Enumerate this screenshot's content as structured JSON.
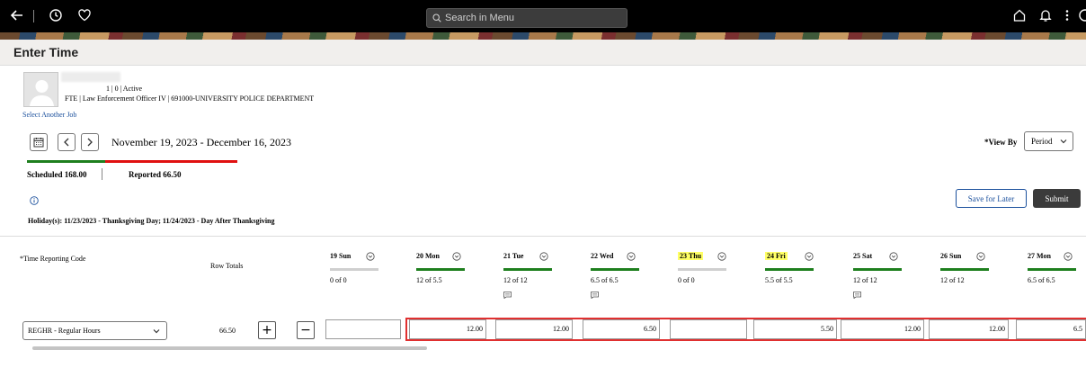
{
  "topbar": {
    "search_placeholder": "Search in Menu"
  },
  "page": {
    "title": "Enter Time"
  },
  "employee": {
    "status_line": "1 | 0 | Active",
    "job_line": "FTE | Law Enforcement Officer IV | 691000-UNIVERSITY POLICE DEPARTMENT",
    "select_job_link": "Select Another Job"
  },
  "period": {
    "range": "November 19, 2023 - December 16, 2023"
  },
  "view_by": {
    "label": "*View By",
    "value": "Period"
  },
  "summary": {
    "scheduled": "Scheduled  168.00",
    "reported": "Reported  66.50",
    "scheduled_hours": 168.0,
    "reported_hours": 66.5
  },
  "holiday_text": "Holiday(s): 11/23/2023 - Thanksgiving Day; 11/24/2023 - Day After Thanksgiving",
  "actions": {
    "save_for_later": "Save for Later",
    "submit": "Submit"
  },
  "grid": {
    "trc_header": "*Time Reporting Code",
    "row_totals_header": "Row Totals",
    "days": [
      {
        "label": "19 Sun",
        "hours": "0 of 0",
        "holiday": false,
        "bar": "grey",
        "comment": false
      },
      {
        "label": "20 Mon",
        "hours": "12 of 5.5",
        "holiday": false,
        "bar": "green",
        "comment": false
      },
      {
        "label": "21 Tue",
        "hours": "12 of 12",
        "holiday": false,
        "bar": "green",
        "comment": true
      },
      {
        "label": "22 Wed",
        "hours": "6.5 of 6.5",
        "holiday": false,
        "bar": "green",
        "comment": true
      },
      {
        "label": "23 Thu",
        "hours": "0 of 0",
        "holiday": true,
        "bar": "grey",
        "comment": false
      },
      {
        "label": "24 Fri",
        "hours": "5.5 of 5.5",
        "holiday": true,
        "bar": "green",
        "comment": false
      },
      {
        "label": "25 Sat",
        "hours": "12 of 12",
        "holiday": false,
        "bar": "green",
        "comment": true
      },
      {
        "label": "26 Sun",
        "hours": "12 of 12",
        "holiday": false,
        "bar": "green",
        "comment": false
      },
      {
        "label": "27 Mon",
        "hours": "6.5 of 6.5",
        "holiday": false,
        "bar": "green",
        "comment": false
      }
    ],
    "row": {
      "trc": "REGHR - Regular Hours",
      "total": "66.50",
      "cells": [
        "",
        "12.00",
        "12.00",
        "6.50",
        "",
        "5.50",
        "12.00",
        "12.00",
        "6.5"
      ]
    }
  },
  "colors": {
    "accent_green": "#1e7f1e",
    "accent_red": "#e01010",
    "link_blue": "#1a4f9c",
    "holiday_highlight": "#ffff66"
  }
}
